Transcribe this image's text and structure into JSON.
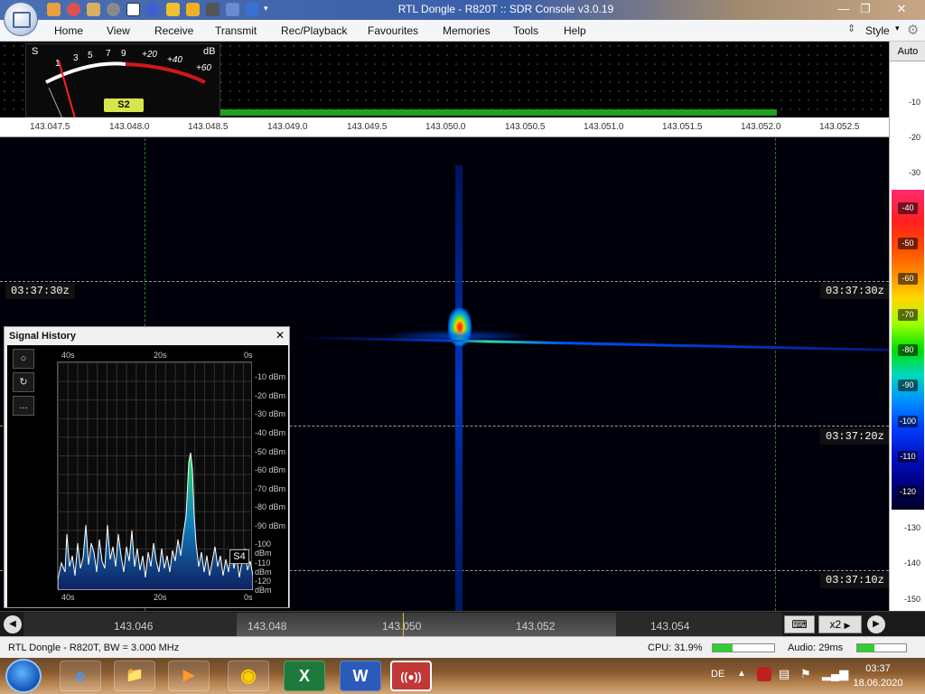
{
  "window": {
    "title": "RTL Dongle - R820T :: SDR Console v3.0.19",
    "minimize_icon": "minimize-icon",
    "maximize_icon": "maximize-icon",
    "close_icon": "close-icon"
  },
  "menu": {
    "items": [
      "Home",
      "View",
      "Receive",
      "Transmit",
      "Rec/Playback",
      "Favourites",
      "Memories",
      "Tools",
      "Help"
    ],
    "style_label": "Style"
  },
  "smeter": {
    "s_label": "S",
    "db_label": "dB",
    "scale": [
      "1",
      "3",
      "5",
      "7",
      "9",
      "+20",
      "+40",
      "+60"
    ],
    "reading": "S2"
  },
  "freq_axis": [
    "143.047.5",
    "143.048.0",
    "143.048.5",
    "143.049.0",
    "143.049.5",
    "143.050.0",
    "143.050.5",
    "143.051.0",
    "143.051.5",
    "143.052.0",
    "143.052.5"
  ],
  "right_scale": {
    "auto_label": "Auto",
    "top_labels": [
      "-10",
      "-20",
      "-30"
    ],
    "color_labels": [
      "-40",
      "-50",
      "-60",
      "-70",
      "-80",
      "-90",
      "-100",
      "-110",
      "-120"
    ],
    "bottom_labels": [
      "-130",
      "-140",
      "-150"
    ]
  },
  "waterfall": {
    "timestamps": [
      "03:37:30z",
      "03:37:20z",
      "03:37:10z"
    ]
  },
  "signal_history": {
    "title": "Signal History",
    "buttons": [
      "○",
      "↻",
      "..."
    ],
    "top_time_labels": [
      "40s",
      "20s",
      "0s"
    ],
    "bottom_time_labels": [
      "40s",
      "20s",
      "0s"
    ],
    "dbm_labels": [
      "-10 dBm",
      "-20 dBm",
      "-30 dBm",
      "-40 dBm",
      "-50 dBm",
      "-60 dBm",
      "-70 dBm",
      "-80 dBm",
      "-90 dBm",
      "-100 dBm",
      "-110 dBm",
      "-120 dBm"
    ],
    "badge": "S4"
  },
  "tuner": {
    "labels": [
      "143.046",
      "143.048",
      "143.050",
      "143.052",
      "143.054"
    ],
    "zoom": "x2"
  },
  "status": {
    "device": "RTL Dongle - R820T, BW = 3.000 MHz",
    "cpu": "CPU: 31.9%",
    "cpu_fraction": 0.32,
    "audio": "Audio: 29ms",
    "audio_fraction": 0.35
  },
  "taskbar": {
    "apps": [
      "e",
      "📁",
      "▶",
      "◉",
      "X",
      "W",
      "((●))"
    ],
    "lang": "DE",
    "time": "03:37",
    "date": "18.06.2020"
  },
  "colors": {
    "accent": "#2fcf2f",
    "spectrum_bar": "#1fa01f",
    "smeter_reading_bg": "#d6e64a"
  }
}
